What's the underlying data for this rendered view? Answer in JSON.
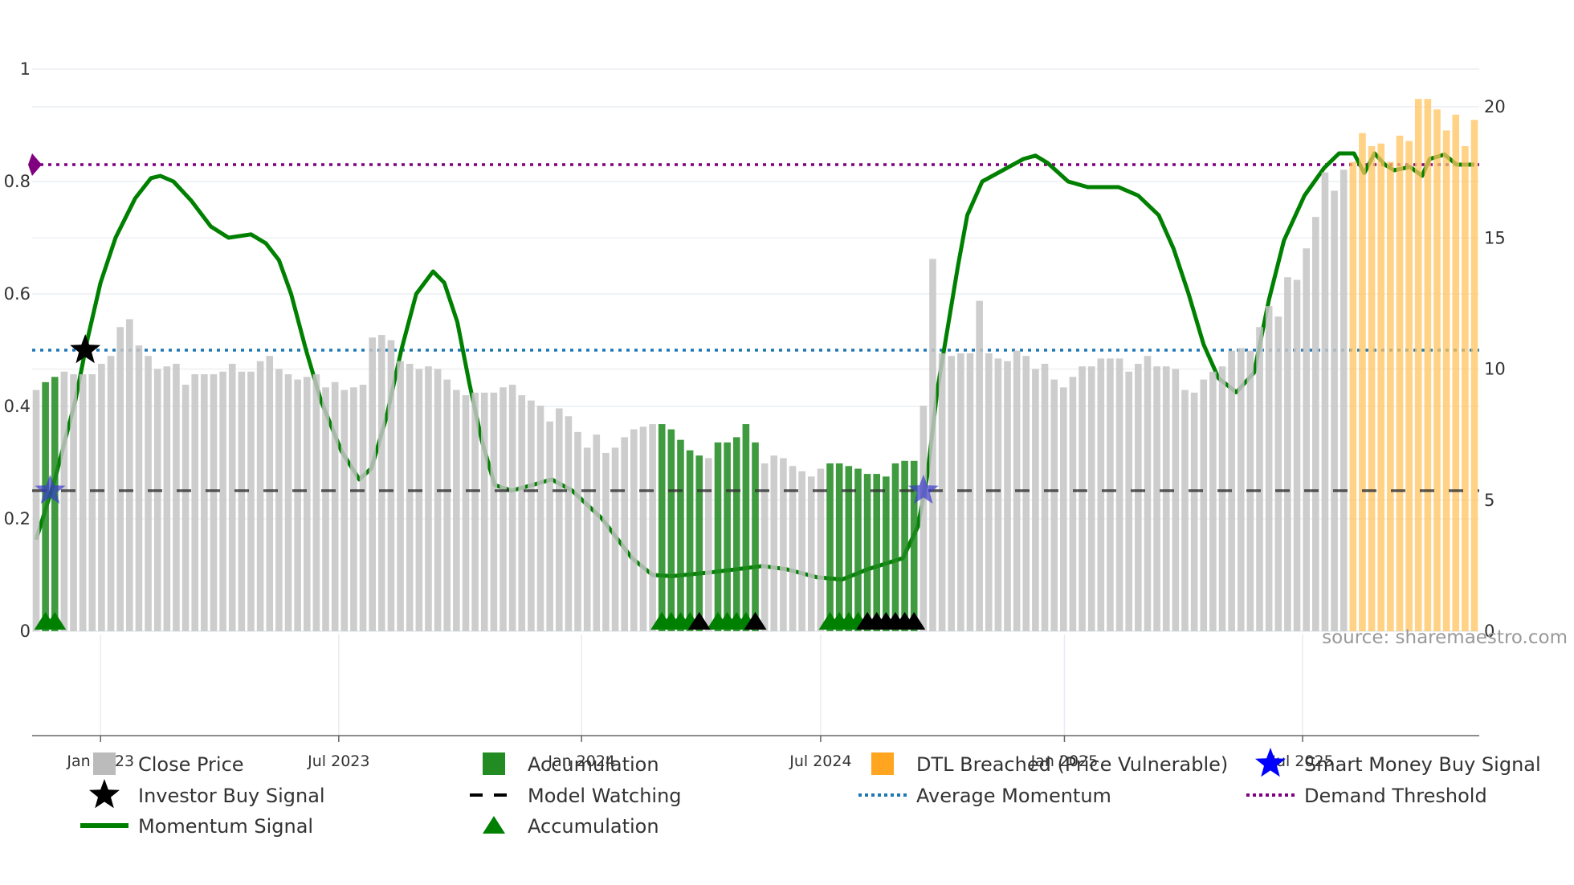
{
  "chart_data": {
    "type": "bar",
    "title": "",
    "xlabel": "",
    "ylabel_left": "",
    "ylabel_right": "",
    "left_axis": {
      "range": [
        0,
        1
      ],
      "ticks": [
        "0",
        "0.2",
        "0.4",
        "0.6",
        "0.8",
        "1"
      ]
    },
    "right_axis": {
      "range": [
        0,
        20
      ],
      "ticks": [
        "0",
        "5",
        "10",
        "15",
        "20"
      ]
    },
    "x_ticks": [
      {
        "label": "Jan 2023",
        "week": 6.9
      },
      {
        "label": "Jul 2023",
        "week": 32.4
      },
      {
        "label": "Jan 2024",
        "week": 58.4
      },
      {
        "label": "Jul 2024",
        "week": 84.0
      },
      {
        "label": "Jan 2025",
        "week": 110.1
      },
      {
        "label": "Jul 2025",
        "week": 135.6
      }
    ],
    "close_price": [
      9.2,
      9.5,
      9.7,
      9.9,
      9.8,
      9.8,
      9.8,
      10.2,
      10.5,
      11.6,
      11.9,
      10.9,
      10.5,
      10.0,
      10.1,
      10.2,
      9.4,
      9.8,
      9.8,
      9.8,
      9.9,
      10.2,
      9.9,
      9.9,
      10.3,
      10.5,
      10.0,
      9.8,
      9.6,
      9.7,
      9.8,
      9.3,
      9.5,
      9.2,
      9.3,
      9.4,
      11.2,
      11.3,
      11.1,
      10.3,
      10.2,
      10.0,
      10.1,
      10.0,
      9.6,
      9.2,
      9.0,
      9.1,
      9.1,
      9.1,
      9.3,
      9.4,
      9.0,
      8.8,
      8.6,
      8.0,
      8.5,
      8.2,
      7.6,
      7.0,
      7.5,
      6.8,
      7.0,
      7.4,
      7.7,
      7.8,
      7.9,
      7.9,
      7.7,
      7.3,
      6.9,
      6.7,
      6.6,
      7.2,
      7.2,
      7.4,
      7.9,
      7.2,
      6.4,
      6.7,
      6.6,
      6.3,
      6.1,
      5.9,
      6.2,
      6.4,
      6.4,
      6.3,
      6.2,
      6.0,
      6.0,
      5.9,
      6.4,
      6.5,
      6.5,
      8.6,
      14.2,
      10.6,
      10.5,
      10.6,
      10.6,
      12.6,
      10.6,
      10.4,
      10.3,
      10.7,
      10.5,
      10.0,
      10.2,
      9.6,
      9.3,
      9.7,
      10.1,
      10.1,
      10.4,
      10.4,
      10.4,
      9.9,
      10.2,
      10.5,
      10.1,
      10.1,
      10.0,
      9.2,
      9.1,
      9.6,
      9.9,
      10.1,
      10.7,
      10.8,
      10.7,
      11.6,
      12.4,
      12.0,
      13.5,
      13.4,
      14.6,
      15.8,
      17.5,
      16.8,
      17.6,
      17.9,
      19.0,
      18.5,
      18.6,
      17.9,
      18.9,
      18.7,
      20.3,
      20.3,
      19.9,
      19.1,
      19.7,
      18.5,
      19.5
    ],
    "accumulation_weeks": [
      1,
      2,
      67,
      68,
      69,
      70,
      71,
      73,
      74,
      75,
      76,
      77,
      85,
      86,
      87,
      88,
      89,
      90,
      91,
      92,
      93,
      94
    ],
    "dtl_breached_weeks": [
      141,
      142,
      143,
      144,
      145,
      146,
      147,
      148,
      149,
      150,
      151,
      152,
      153,
      154
    ],
    "momentum_signal": [
      [
        0,
        0.163
      ],
      [
        2,
        0.27
      ],
      [
        4.2,
        0.41
      ],
      [
        5.5,
        0.52
      ],
      [
        6.9,
        0.62
      ],
      [
        8.5,
        0.7
      ],
      [
        10.6,
        0.77
      ],
      [
        12.3,
        0.806
      ],
      [
        13.3,
        0.81
      ],
      [
        14.7,
        0.8
      ],
      [
        16.6,
        0.766
      ],
      [
        18.7,
        0.72
      ],
      [
        20.6,
        0.7
      ],
      [
        23,
        0.706
      ],
      [
        24.6,
        0.69
      ],
      [
        26,
        0.66
      ],
      [
        27.3,
        0.6
      ],
      [
        28.9,
        0.5
      ],
      [
        30.5,
        0.41
      ],
      [
        32.7,
        0.32
      ],
      [
        34.6,
        0.27
      ],
      [
        35.9,
        0.29
      ],
      [
        37.5,
        0.38
      ],
      [
        39.1,
        0.5
      ],
      [
        40.7,
        0.6
      ],
      [
        42.5,
        0.64
      ],
      [
        43.7,
        0.62
      ],
      [
        45.1,
        0.55
      ],
      [
        46.4,
        0.44
      ],
      [
        47.7,
        0.34
      ],
      [
        49.1,
        0.26
      ],
      [
        50.9,
        0.25
      ],
      [
        53.1,
        0.26
      ],
      [
        55.2,
        0.27
      ],
      [
        57.4,
        0.25
      ],
      [
        60.6,
        0.2
      ],
      [
        63.8,
        0.13
      ],
      [
        66,
        0.1
      ],
      [
        68.1,
        0.098
      ],
      [
        72.4,
        0.105
      ],
      [
        77.8,
        0.116
      ],
      [
        80.4,
        0.11
      ],
      [
        83.6,
        0.096
      ],
      [
        86.3,
        0.092
      ],
      [
        89,
        0.11
      ],
      [
        92.8,
        0.13
      ],
      [
        94.4,
        0.186
      ],
      [
        95.4,
        0.275
      ],
      [
        96.5,
        0.43
      ],
      [
        97.6,
        0.54
      ],
      [
        98.7,
        0.65
      ],
      [
        99.7,
        0.74
      ],
      [
        101.3,
        0.8
      ],
      [
        103.5,
        0.82
      ],
      [
        105.7,
        0.84
      ],
      [
        107,
        0.846
      ],
      [
        108.3,
        0.833
      ],
      [
        110.5,
        0.8
      ],
      [
        112.6,
        0.79
      ],
      [
        115.9,
        0.79
      ],
      [
        118,
        0.775
      ],
      [
        120.2,
        0.74
      ],
      [
        121.8,
        0.68
      ],
      [
        123.4,
        0.6
      ],
      [
        125,
        0.51
      ],
      [
        126.6,
        0.45
      ],
      [
        128.5,
        0.425
      ],
      [
        130.4,
        0.46
      ],
      [
        132,
        0.59
      ],
      [
        133.6,
        0.695
      ],
      [
        135.8,
        0.775
      ],
      [
        137.9,
        0.824
      ],
      [
        139.5,
        0.85
      ],
      [
        141.1,
        0.85
      ],
      [
        142.2,
        0.815
      ],
      [
        143.3,
        0.85
      ],
      [
        144.4,
        0.83
      ],
      [
        145.4,
        0.82
      ],
      [
        147.1,
        0.826
      ],
      [
        148.4,
        0.81
      ],
      [
        149.2,
        0.84
      ],
      [
        150.8,
        0.848
      ],
      [
        152.1,
        0.83
      ],
      [
        154,
        0.83
      ]
    ],
    "average_momentum": 0.5,
    "demand_threshold": 0.83,
    "model_watching": 0.25,
    "investor_buy_signals": [
      {
        "week": 5,
        "value": 0.5
      }
    ],
    "smart_money_buy_signals": [
      {
        "week": 1.5,
        "value": 0.25
      },
      {
        "week": 95,
        "value": 0.25
      }
    ],
    "accumulation_markers": {
      "green": [
        1,
        2,
        67,
        68,
        69,
        70,
        73,
        74,
        75,
        76,
        85,
        86,
        87,
        88
      ],
      "black": [
        71,
        77,
        89,
        90,
        91,
        92,
        93,
        94
      ]
    },
    "legend": {
      "placement": "bottom",
      "items": [
        {
          "label": "Close Price",
          "symbol": "bar",
          "color": "#bbbbbb"
        },
        {
          "label": "Accumulation",
          "symbol": "bar",
          "color": "#228b22"
        },
        {
          "label": "DTL Breached (Price Vulnerable)",
          "symbol": "bar",
          "color": "#ffa51f"
        },
        {
          "label": "Smart Money Buy Signal",
          "symbol": "star",
          "color": "#0000ff"
        },
        {
          "label": "Investor Buy Signal",
          "symbol": "star",
          "color": "#000000"
        },
        {
          "label": "Model Watching",
          "symbol": "dash",
          "color": "#000000"
        },
        {
          "label": "Average Momentum",
          "symbol": "dot",
          "color": "#1f77b4"
        },
        {
          "label": "Demand Threshold",
          "symbol": "dot",
          "color": "#800080"
        },
        {
          "label": "Momentum Signal",
          "symbol": "line",
          "color": "#008000"
        },
        {
          "label": "Accumulation",
          "symbol": "triangle",
          "color": "#008000"
        }
      ]
    },
    "grid": true,
    "source": "source: sharemaestro.com"
  }
}
